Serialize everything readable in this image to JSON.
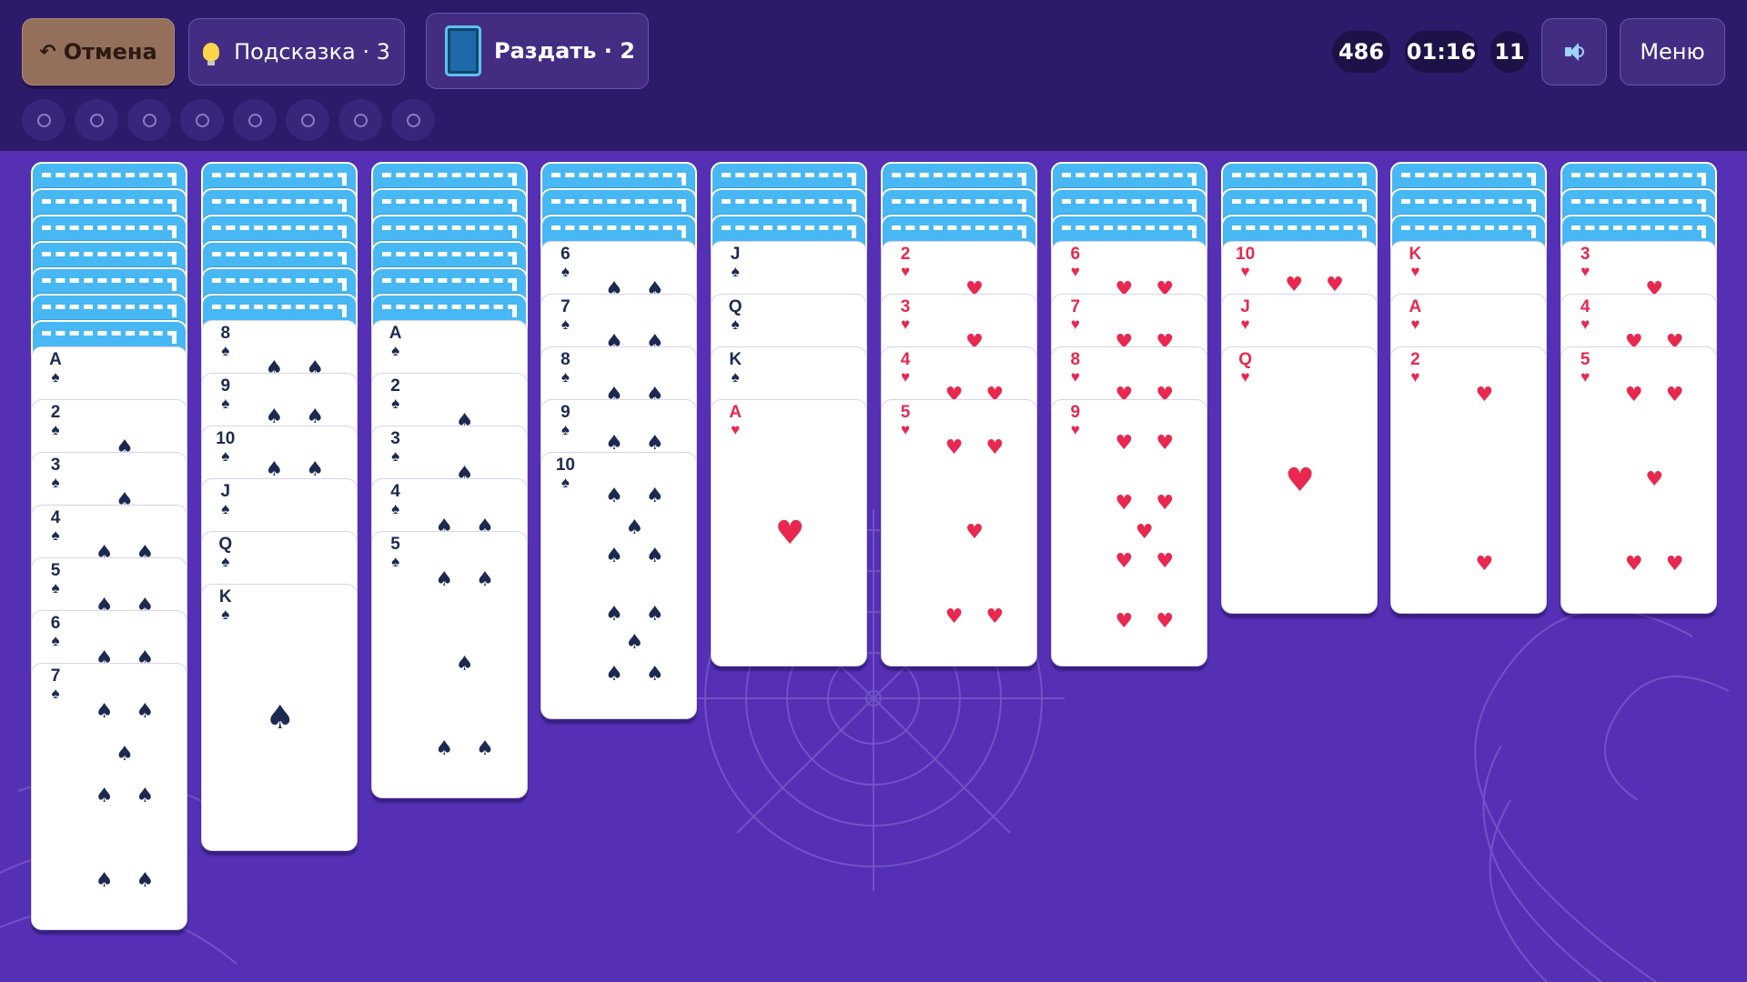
{
  "toolbar": {
    "undo_label": "Отмена",
    "hint_label": "Подсказка · 3",
    "deal_label": "Раздать  · 2",
    "menu_label": "Меню",
    "sound_icon": "speaker-icon"
  },
  "stats": {
    "score": "486",
    "time": "01:16",
    "moves": "11"
  },
  "foundations": {
    "slots": 8,
    "completed": 0
  },
  "colors": {
    "bg": "#5530b5",
    "topbar": "#2c1a6a",
    "card_back": "#47b8f3",
    "red_suit": "#e8284f",
    "black_suit": "#1c2a52"
  },
  "tableau": [
    {
      "facedown": 7,
      "cards": [
        [
          "A",
          "♠"
        ],
        [
          "2",
          "♠"
        ],
        [
          "3",
          "♠"
        ],
        [
          "4",
          "♠"
        ],
        [
          "5",
          "♠"
        ],
        [
          "6",
          "♠"
        ],
        [
          "7",
          "♠"
        ]
      ]
    },
    {
      "facedown": 6,
      "cards": [
        [
          "8",
          "♠"
        ],
        [
          "9",
          "♠"
        ],
        [
          "10",
          "♠"
        ],
        [
          "J",
          "♠"
        ],
        [
          "Q",
          "♠"
        ],
        [
          "K",
          "♠"
        ]
      ]
    },
    {
      "facedown": 6,
      "cards": [
        [
          "A",
          "♠"
        ],
        [
          "2",
          "♠"
        ],
        [
          "3",
          "♠"
        ],
        [
          "4",
          "♠"
        ],
        [
          "5",
          "♠"
        ]
      ]
    },
    {
      "facedown": 3,
      "cards": [
        [
          "6",
          "♠"
        ],
        [
          "7",
          "♠"
        ],
        [
          "8",
          "♠"
        ],
        [
          "9",
          "♠"
        ],
        [
          "10",
          "♠"
        ]
      ]
    },
    {
      "facedown": 3,
      "cards": [
        [
          "J",
          "♠"
        ],
        [
          "Q",
          "♠"
        ],
        [
          "K",
          "♠"
        ],
        [
          "A",
          "♥"
        ]
      ]
    },
    {
      "facedown": 3,
      "cards": [
        [
          "2",
          "♥"
        ],
        [
          "3",
          "♥"
        ],
        [
          "4",
          "♥"
        ],
        [
          "5",
          "♥"
        ]
      ]
    },
    {
      "facedown": 3,
      "cards": [
        [
          "6",
          "♥"
        ],
        [
          "7",
          "♥"
        ],
        [
          "8",
          "♥"
        ],
        [
          "9",
          "♥"
        ]
      ]
    },
    {
      "facedown": 3,
      "cards": [
        [
          "10",
          "♥"
        ],
        [
          "J",
          "♥"
        ],
        [
          "Q",
          "♥"
        ]
      ]
    },
    {
      "facedown": 3,
      "cards": [
        [
          "K",
          "♥"
        ],
        [
          "A",
          "♥"
        ],
        [
          "2",
          "♥"
        ]
      ]
    },
    {
      "facedown": 3,
      "cards": [
        [
          "3",
          "♥"
        ],
        [
          "4",
          "♥"
        ],
        [
          "5",
          "♥"
        ]
      ]
    }
  ]
}
